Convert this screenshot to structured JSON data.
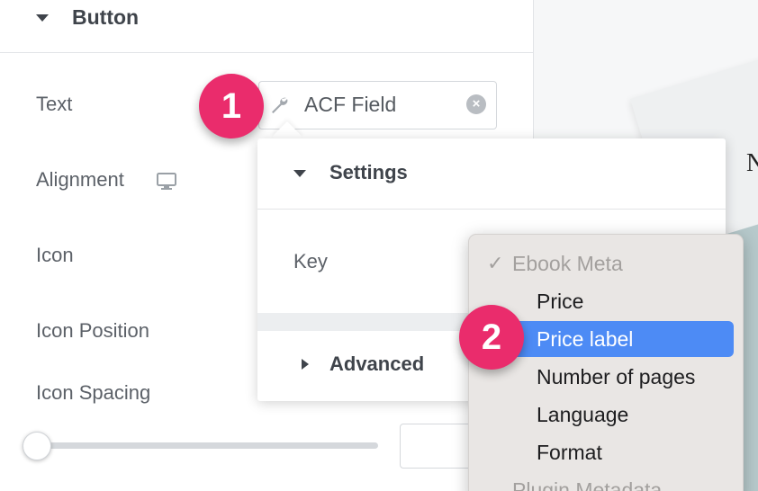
{
  "section": {
    "title": "Button"
  },
  "controls": {
    "text_label": "Text",
    "alignment_label": "Alignment",
    "icon_label": "Icon",
    "icon_position_label": "Icon Position",
    "icon_spacing_label": "Icon Spacing"
  },
  "text_field": {
    "value": "ACF Field",
    "clear_glyph": "×",
    "icon": "wrench-icon"
  },
  "alignment": {
    "icon": "desktop-icon"
  },
  "icon_spacing": {
    "slider_level": 0,
    "value": ""
  },
  "popover": {
    "settings_title": "Settings",
    "key_label": "Key",
    "advanced_title": "Advanced"
  },
  "dropdown": {
    "group_label": "Ebook Meta",
    "check_glyph": "✓",
    "items": [
      "Price",
      "Price label",
      "Number of pages",
      "Language",
      "Format"
    ],
    "selected": "Price label",
    "next_group_label": "Plugin Metadata"
  },
  "steps": [
    "1",
    "2"
  ],
  "preview": {
    "letter": "N"
  },
  "colors": {
    "step_marker": "#ea2c6c",
    "menu_highlight": "#4d8bf5",
    "menu_background": "#e9e6e4",
    "preview_book": "#b6c9cb"
  }
}
